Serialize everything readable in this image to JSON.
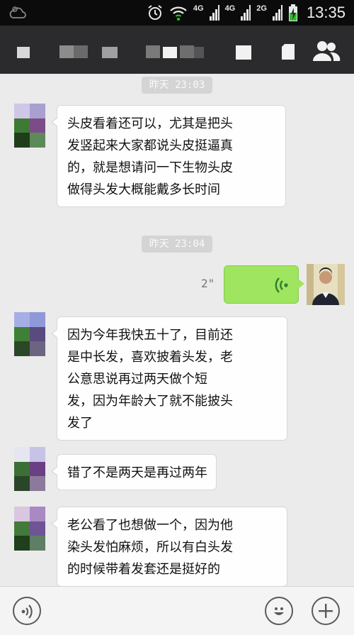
{
  "status_bar": {
    "left_icon": "weather-icon",
    "icons": [
      "alarm-clock-icon",
      "wifi-icon",
      "signal-4g-icon",
      "signal-4g-icon",
      "signal-2g-icon",
      "battery-charging-icon"
    ],
    "network_1": "4G",
    "network_2": "4G",
    "network_3": "2G",
    "time": "13:35"
  },
  "title_bar": {
    "title": "",
    "right_icons": [
      "phone-icon",
      "file-icon",
      "contacts-icon"
    ]
  },
  "messages": [
    {
      "type": "timestamp",
      "text": "昨天 23:03"
    },
    {
      "type": "text",
      "side": "left",
      "lines": [
        "头皮看着还可以，尤其是把头",
        "发竖起来大家都说头皮挺逼真",
        "的，就是想请问一下生物头皮",
        "做得头发大概能戴多长时间"
      ]
    },
    {
      "type": "timestamp",
      "text": "昨天 23:04"
    },
    {
      "type": "voice",
      "side": "right",
      "duration": "2\""
    },
    {
      "type": "text",
      "side": "left",
      "lines": [
        "因为今年我快五十了，目前还",
        "是中长发，喜欢披着头发，老",
        "公意思说再过两天做个短",
        "发，因为年龄大了就不能披头",
        "发了"
      ]
    },
    {
      "type": "text",
      "side": "left",
      "lines": [
        "错了不是两天是再过两年"
      ]
    },
    {
      "type": "text",
      "side": "left",
      "lines": [
        "老公看了也想做一个，因为他",
        "染头发怕麻烦，所以有白头发",
        "的时候带着发套还是挺好的"
      ]
    }
  ],
  "input_bar": {
    "voice_button": "voice-input-icon",
    "emoji_button": "emoji-icon",
    "plus_button": "plus-icon"
  },
  "colors": {
    "status_bar": "#0b0b0b",
    "title_bar": "#2b2b2d",
    "chat_background": "#ebebeb",
    "voice_bubble": "#9fe55f",
    "timestamp_pill": "#d4d4d4"
  }
}
